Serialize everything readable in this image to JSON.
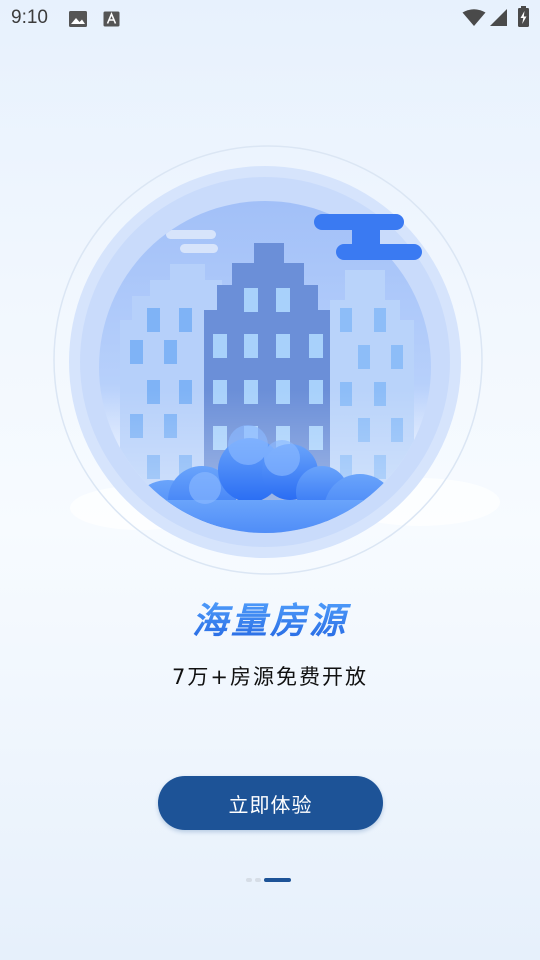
{
  "status_bar": {
    "time": "9:10",
    "left_icons": [
      "image-icon",
      "text-a-icon"
    ],
    "right_icons": [
      "wifi-icon",
      "signal-icon",
      "battery-charging-icon"
    ]
  },
  "illustration": {
    "icon": "city-buildings-illustration"
  },
  "onboarding": {
    "headline": "海量房源",
    "subtitle": "7万+房源免费开放",
    "cta_label": "立即体验"
  },
  "pager": {
    "page_count": 3,
    "active_index": 2
  },
  "colors": {
    "accent": "#2f7ff0",
    "button": "#1d5397",
    "background": "#eef5fd"
  }
}
